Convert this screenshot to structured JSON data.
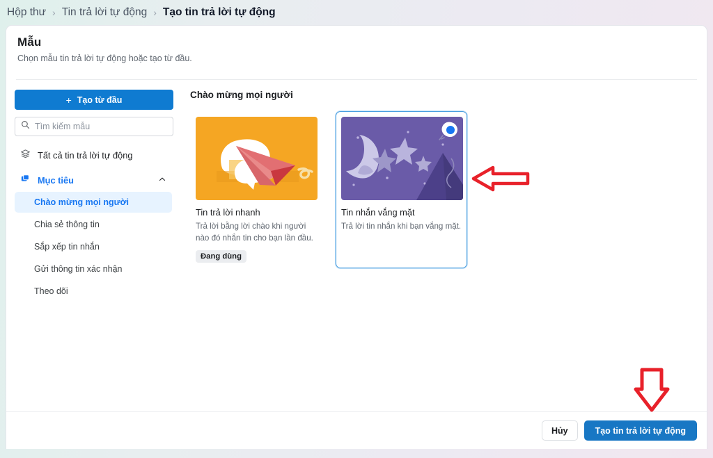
{
  "breadcrumb": {
    "separator": "›",
    "items": [
      {
        "label": "Hộp thư",
        "current": false
      },
      {
        "label": "Tin trả lời tự động",
        "current": false
      },
      {
        "label": "Tạo tin trả lời tự động",
        "current": true
      }
    ]
  },
  "panel": {
    "title": "Mẫu",
    "subtitle": "Chọn mẫu tin trả lời tự động hoặc tạo từ đầu."
  },
  "sidebar": {
    "create_button": {
      "label": "Tạo từ đầu",
      "plus": "+"
    },
    "search": {
      "placeholder": "Tìm kiếm mẫu",
      "value": ""
    },
    "all_item": {
      "label": "Tất cả tin trả lời tự động"
    },
    "group": {
      "label": "Mục tiêu",
      "expanded": true
    },
    "sub_items": [
      {
        "label": "Chào mừng mọi người",
        "active": true
      },
      {
        "label": "Chia sẻ thông tin",
        "active": false
      },
      {
        "label": "Sắp xếp tin nhắn",
        "active": false
      },
      {
        "label": "Gửi thông tin xác nhận",
        "active": false
      },
      {
        "label": "Theo dõi",
        "active": false
      }
    ]
  },
  "content": {
    "section_title": "Chào mừng mọi người",
    "cards": [
      {
        "title": "Tin trả lời nhanh",
        "description": "Trả lời bằng lời chào khi người nào đó nhắn tin cho bạn lần đầu.",
        "badge": "Đang dùng",
        "selected": false,
        "thumb": "paper-plane-chat-illustration",
        "thumb_bg": "#F5A623"
      },
      {
        "title": "Tin nhắn vắng mặt",
        "description": "Trả lời tin nhắn khi bạn vắng mặt.",
        "badge": "",
        "selected": true,
        "thumb": "night-moon-mountain-illustration",
        "thumb_bg": "#6A5BA8"
      }
    ]
  },
  "footer": {
    "cancel_label": "Hủy",
    "submit_label": "Tạo tin trả lời tự động"
  },
  "annotations": [
    {
      "name": "arrow-pointing-at-selected-card",
      "direction": "left"
    },
    {
      "name": "arrow-pointing-at-submit-button",
      "direction": "down"
    }
  ],
  "colors": {
    "primary_blue": "#1877f2",
    "button_blue": "#0f7bd1",
    "submit_blue": "#1877c4",
    "active_bg": "#e7f3ff",
    "annotation_red": "#e8212a"
  }
}
